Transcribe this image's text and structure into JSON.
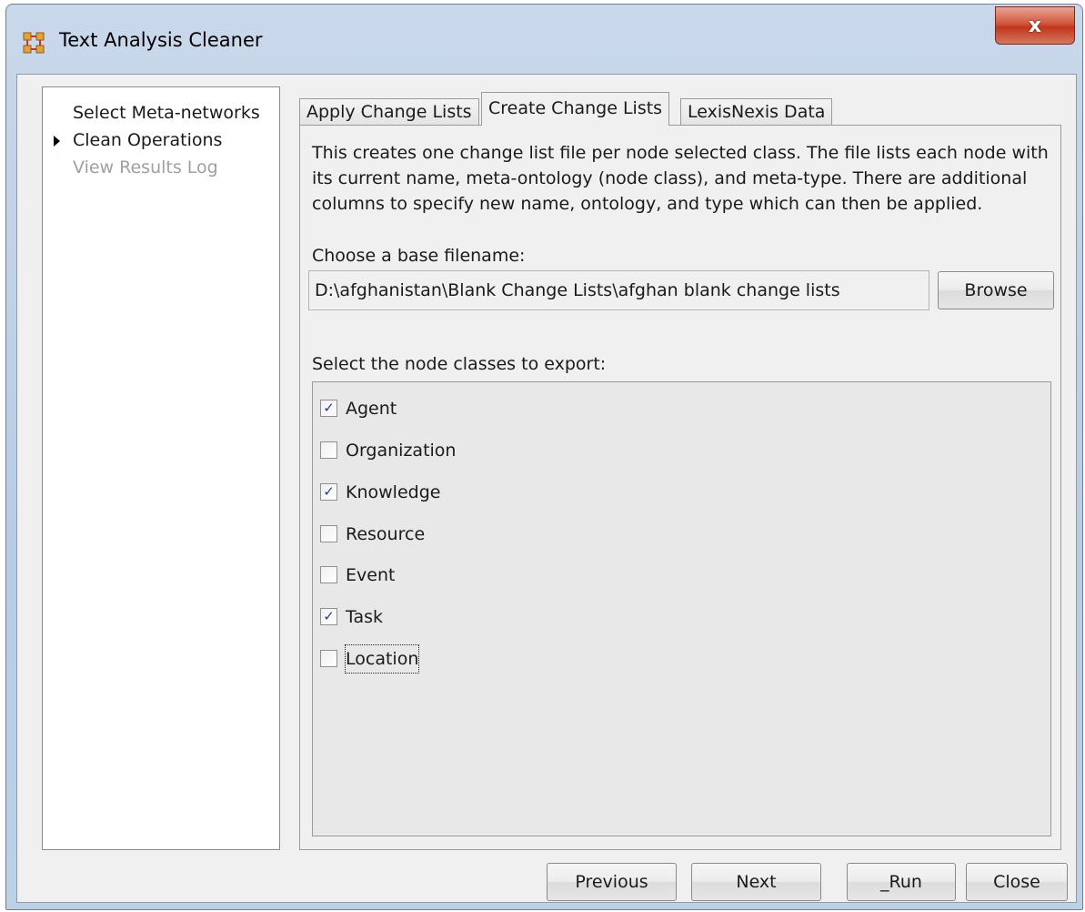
{
  "window": {
    "title": "Text Analysis Cleaner",
    "close_glyph": "x"
  },
  "sidebar": {
    "items": [
      {
        "label": "Select Meta-networks",
        "state": "normal"
      },
      {
        "label": "Clean Operations",
        "state": "current"
      },
      {
        "label": "View Results Log",
        "state": "disabled"
      }
    ]
  },
  "tabs": [
    {
      "label": "Apply Change Lists"
    },
    {
      "label": "Create Change Lists"
    },
    {
      "label": "LexisNexis Data"
    }
  ],
  "active_tab": "Create Change Lists",
  "panel": {
    "description": "This creates one change list file per node selected class. The file lists each node with its current name, meta-ontology (node class), and meta-type. There are additional columns to specify new name, ontology, and type which can then be applied.",
    "filename_label": "Choose a base filename:",
    "filename_value": "D:\\afghanistan\\Blank Change Lists\\afghan blank change lists",
    "browse_label": "Browse",
    "classes_label": "Select the node classes to export:",
    "node_classes": [
      {
        "label": "Agent",
        "checked": true
      },
      {
        "label": "Organization",
        "checked": false
      },
      {
        "label": "Knowledge",
        "checked": true
      },
      {
        "label": "Resource",
        "checked": false
      },
      {
        "label": "Event",
        "checked": false
      },
      {
        "label": "Task",
        "checked": true
      },
      {
        "label": "Location",
        "checked": false
      }
    ]
  },
  "footer": {
    "previous_label": "Previous",
    "next_label": "Next",
    "run_label": "_Run",
    "close_label": "Close"
  },
  "colors": {
    "checkmark": "#2a3f7a",
    "close_button": "#c0361d",
    "title_bar": "#c9d8ea"
  }
}
